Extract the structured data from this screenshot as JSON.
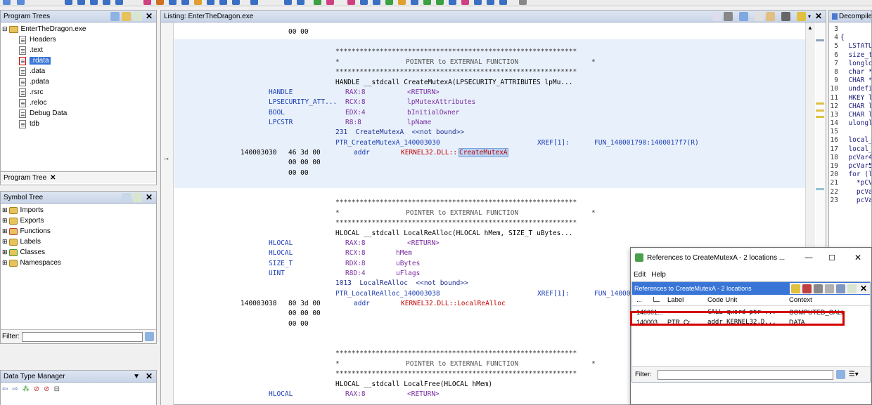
{
  "program_trees": {
    "title": "Program Trees",
    "root": "EnterTheDragon.exe",
    "items": [
      "Headers",
      ".text",
      ".rdata",
      ".data",
      ".pdata",
      ".rsrc",
      ".reloc",
      "Debug Data",
      "tdb"
    ],
    "selected": ".rdata",
    "bottom_tab": "Program Tree"
  },
  "symbol_tree": {
    "title": "Symbol Tree",
    "items": [
      "Imports",
      "Exports",
      "Functions",
      "Labels",
      "Classes",
      "Namespaces"
    ]
  },
  "filter": {
    "label": "Filter:",
    "value": ""
  },
  "dtm": {
    "title": "Data Type Manager"
  },
  "listing": {
    "title": "Listing: EnterTheDragon.exe",
    "stars": "************************************************************",
    "ptr_ext": "POINTER to EXTERNAL FUNCTION",
    "star_l": "*",
    "star_r": "*",
    "top_bytes": "00 00",
    "b1": {
      "sig": "HANDLE __stdcall CreateMutexA(LPSECURITY_ATTRIBUTES lpMu...",
      "params": [
        [
          "HANDLE",
          "RAX:8",
          "<RETURN>"
        ],
        [
          "LPSECURITY_ATT...",
          "RCX:8",
          "lpMutexAttributes"
        ],
        [
          "BOOL",
          "EDX:4",
          "bInitialOwner"
        ],
        [
          "LPCSTR",
          "R8:8",
          "lpName"
        ]
      ],
      "ordinal": "231  CreateMutexA  <<not bound>>",
      "label": "PTR_CreateMutexA_140003030",
      "xref": "XREF[1]:",
      "xref_to": "FUN_140001790:1400017f7(R)",
      "addr": "140003030",
      "bytes": "46 3d 00",
      "mnem": "addr",
      "ref_prefix": "KERNEL32.DLL::",
      "ref_name": "CreateMutexA",
      "more1": "00 00 00",
      "more2": "00 00"
    },
    "b2": {
      "sig": "HLOCAL __stdcall LocalReAlloc(HLOCAL hMem, SIZE_T uBytes...",
      "params": [
        [
          "HLOCAL",
          "RAX:8",
          "<RETURN>"
        ],
        [
          "HLOCAL",
          "RCX:8",
          "hMem"
        ],
        [
          "SIZE_T",
          "RDX:8",
          "uBytes"
        ],
        [
          "UINT",
          "R8D:4",
          "uFlags"
        ]
      ],
      "ordinal": "1013  LocalReAlloc  <<not bound>>",
      "label": "PTR_LocalReAlloc_140003038",
      "xref": "XREF[1]:",
      "xref_to": "FUN_14000",
      "addr": "140003038",
      "bytes": "80 3d 00",
      "mnem": "addr",
      "ref": "KERNEL32.DLL::LocalReAlloc",
      "more1": "00 00 00",
      "more2": "00 00"
    },
    "b3": {
      "sig": "HLOCAL __stdcall LocalFree(HLOCAL hMem)",
      "params": [
        [
          "HLOCAL",
          "RAX:8",
          "<RETURN>"
        ]
      ]
    }
  },
  "decompile": {
    "title": "Decompile",
    "lines": [
      [
        "3",
        ""
      ],
      [
        "4",
        "{"
      ],
      [
        "5",
        "  LSTATU"
      ],
      [
        "6",
        "  size_t"
      ],
      [
        "7",
        "  longlo"
      ],
      [
        "8",
        "  char *"
      ],
      [
        "9",
        "  CHAR *"
      ],
      [
        "10",
        "  undefi"
      ],
      [
        "11",
        "  HKEY l"
      ],
      [
        "12",
        "  CHAR l"
      ],
      [
        "13",
        "  CHAR l"
      ],
      [
        "14",
        "  ulongl"
      ],
      [
        "15",
        ""
      ],
      [
        "16",
        "  local_"
      ],
      [
        "17",
        "  local_"
      ],
      [
        "18",
        "  pcVar4"
      ],
      [
        "19",
        "  pcVar5"
      ],
      [
        "20",
        "  for (l"
      ],
      [
        "21",
        "    *pCV"
      ],
      [
        "22",
        "    pcVa"
      ],
      [
        "23",
        "    pcVa"
      ]
    ]
  },
  "refs_dialog": {
    "title": "References to CreateMutexA - 2 locations ...",
    "menu": [
      "Edit",
      "Help"
    ],
    "inner_title": "References to CreateMutexA - 2 locations",
    "columns": [
      "...",
      "",
      "Label",
      "Code Unit",
      "Context"
    ],
    "rows": [
      [
        "140001...",
        "",
        "",
        "CALL qword ptr ...",
        "COMPUTED_CALL"
      ],
      [
        "140003...",
        "",
        "PTR_Cr...",
        "addr KERNEL32.D...",
        "DATA"
      ]
    ],
    "filter_label": "Filter:",
    "filter_value": "",
    "win_min": "—",
    "win_max": "☐",
    "win_close": "✕"
  }
}
